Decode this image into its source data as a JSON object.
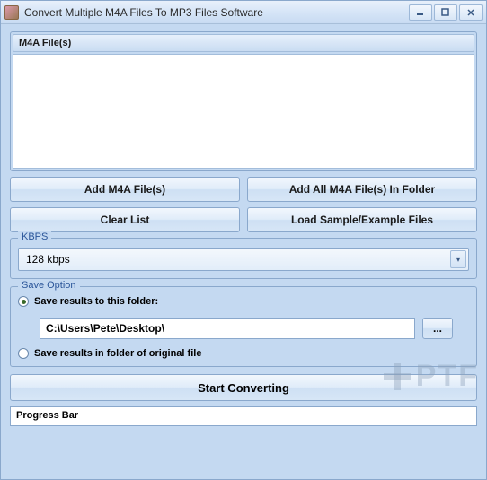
{
  "window": {
    "title": "Convert Multiple M4A Files To MP3 Files Software"
  },
  "files": {
    "header": "M4A File(s)"
  },
  "buttons": {
    "add_files": "Add M4A File(s)",
    "add_folder": "Add All M4A File(s) In Folder",
    "clear_list": "Clear List",
    "load_sample": "Load Sample/Example Files",
    "browse": "...",
    "start": "Start Converting"
  },
  "kbps": {
    "legend": "KBPS",
    "selected": "128 kbps"
  },
  "save": {
    "legend": "Save Option",
    "radio_folder": "Save results to this folder:",
    "radio_original": "Save results in folder of original file",
    "folder_path": "C:\\Users\\Pete\\Desktop\\"
  },
  "progress": {
    "label": "Progress Bar"
  },
  "watermark": "PTF"
}
